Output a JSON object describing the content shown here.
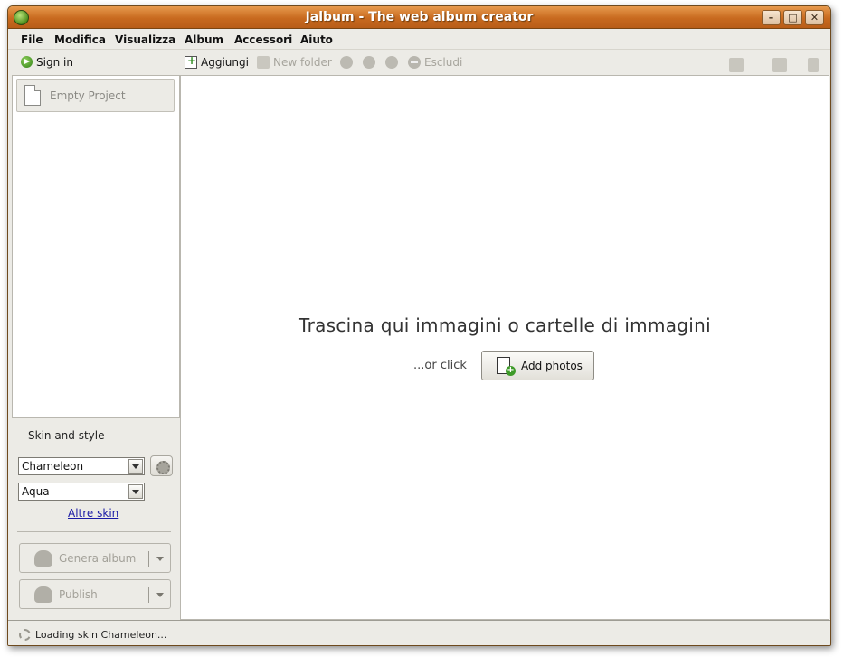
{
  "window": {
    "title": "Jalbum - The web album creator",
    "controls": {
      "minimize": "–",
      "maximize": "□",
      "close": "✕"
    }
  },
  "menu": [
    "File",
    "Modifica",
    "Visualizza",
    "Album",
    "Accessori",
    "Aiuto"
  ],
  "toolbar": {
    "sign_in": "Sign in",
    "add": "Aggiungi",
    "new_folder": "New folder",
    "exclude": "Escludi"
  },
  "projects": [
    {
      "label": "Empty Project"
    }
  ],
  "skin_panel": {
    "legend": "Skin and style",
    "skin": "Chameleon",
    "style": "Aqua",
    "more_skins_link": "Altre skin"
  },
  "actions": {
    "generate": "Genera album",
    "publish": "Publish"
  },
  "main": {
    "drop_hint": "Trascina qui immagini o cartelle di immagini",
    "or_click": "...or click",
    "add_photos": "Add photos"
  },
  "status": {
    "text": "Loading skin Chameleon..."
  },
  "colors": {
    "titlebar": "#c86a1f",
    "panel": "#ecebe6",
    "link": "#1a1aa6"
  }
}
